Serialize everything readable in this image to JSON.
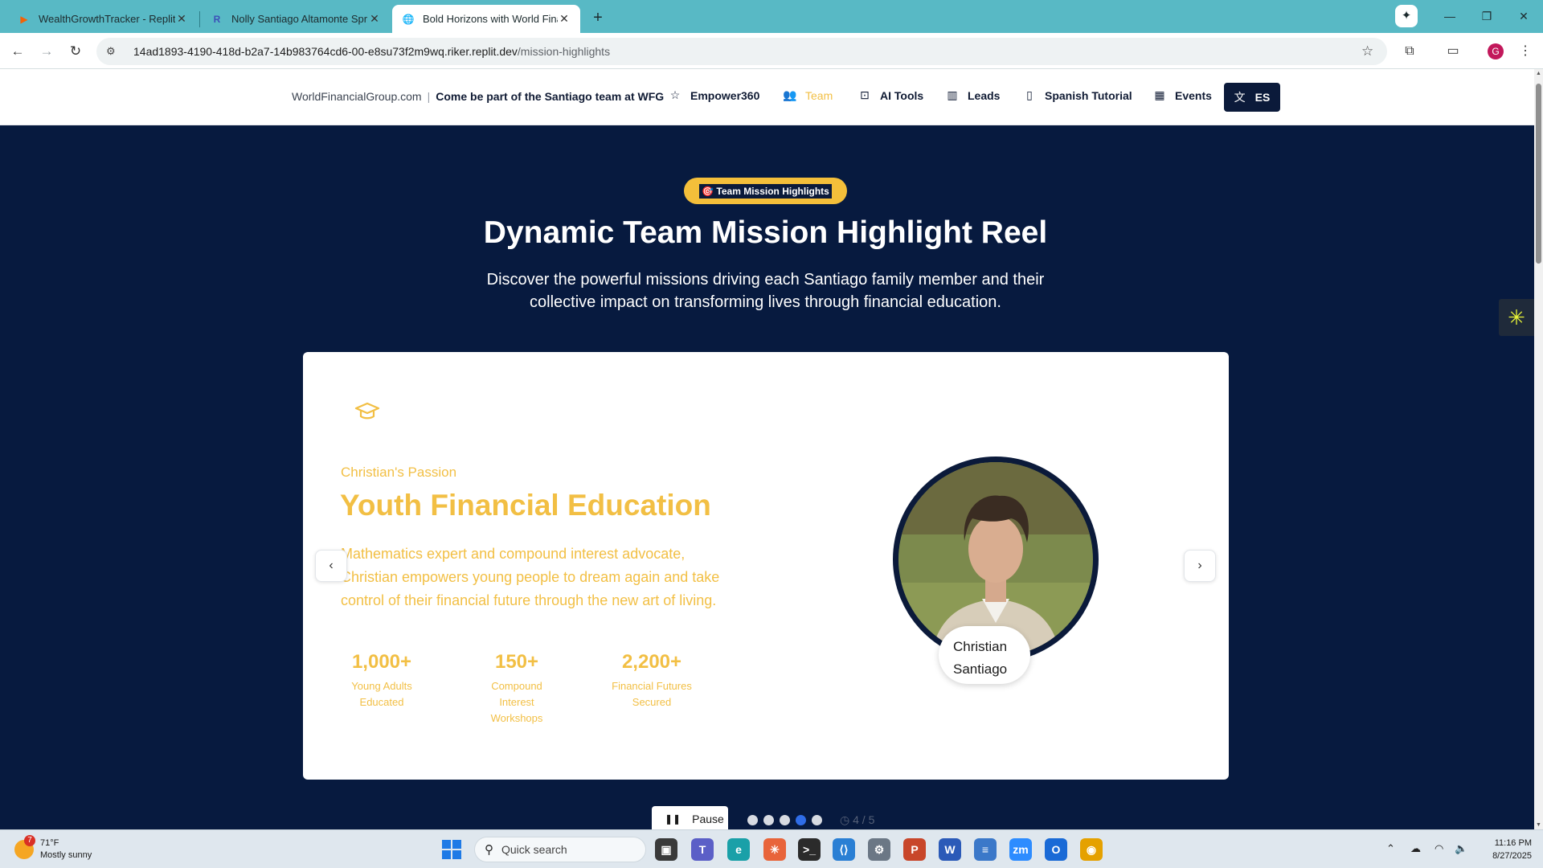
{
  "browser": {
    "tabs": [
      {
        "title": "WealthGrowthTracker - Replit",
        "active": false
      },
      {
        "title": "Nolly Santiago Altamonte Sprin",
        "active": false
      },
      {
        "title": "Bold Horizons with World Finan",
        "active": true
      }
    ],
    "url_host": "14ad1893-4190-418d-b2a7-14b983764cd6-00-e8su73f2m9wq.riker.replit.dev",
    "url_path": "/mission-highlights",
    "profile_initial": "G"
  },
  "nav": {
    "brand": "WorldFinancialGroup.com",
    "separator": "|",
    "cta": "Come be part of the Santiago team at WFG",
    "items": [
      {
        "label": "Empower360",
        "icon": "star-icon"
      },
      {
        "label": "Team",
        "icon": "users-icon"
      },
      {
        "label": "AI Tools",
        "icon": "robot-icon"
      },
      {
        "label": "Leads",
        "icon": "bar-chart-icon"
      },
      {
        "label": "Spanish Tutorial",
        "icon": "book-icon"
      },
      {
        "label": "Events",
        "icon": "calendar-icon"
      }
    ],
    "active_item": "Team",
    "lang_label": "ES",
    "accent_color": "#f2bf44",
    "dark_color": "#0b1a3a"
  },
  "hero": {
    "pill_label": "🎯 Team Mission Highlights",
    "title": "Dynamic Team Mission Highlight Reel",
    "subtitle": "Discover the powerful missions driving each Santiago family member and their collective impact on transforming lives through financial education.",
    "background_color": "#071a3f"
  },
  "slide": {
    "icon": "graduation-cap-icon",
    "passion": "Christian's Passion",
    "headline": "Youth Financial Education",
    "description": "Mathematics expert and compound interest advocate, Christian empowers young people to dream again and take control of their financial future through the new art of living.",
    "stats": [
      {
        "value": "1,000+",
        "label": "Young Adults Educated"
      },
      {
        "value": "150+",
        "label": "Compound Interest Workshops"
      },
      {
        "value": "2,200+",
        "label": "Financial Futures Secured"
      }
    ],
    "person_first": "Christian",
    "person_last": "Santiago"
  },
  "carousel": {
    "pause_label": "Pause",
    "dots": 5,
    "active_index": 4,
    "counter": "4 / 5"
  },
  "taskbar": {
    "weather_temp": "71°F",
    "weather_desc": "Mostly sunny",
    "weather_badge": "7",
    "search_placeholder": "Quick search",
    "time": "11:16 PM",
    "date": "8/27/2025"
  }
}
